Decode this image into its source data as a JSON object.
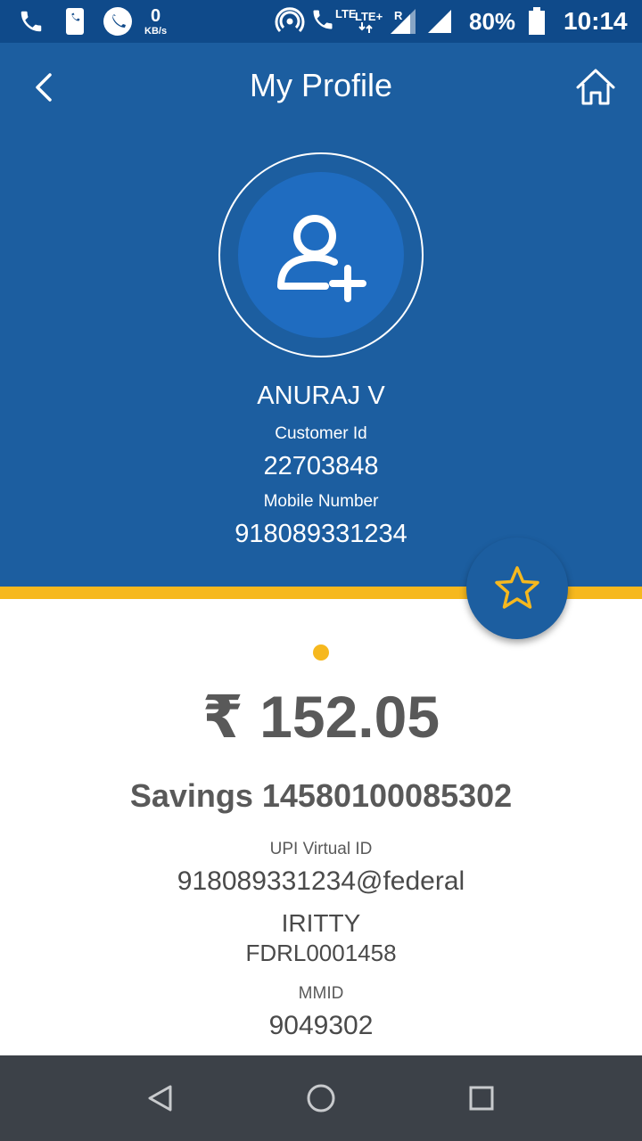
{
  "status_bar": {
    "data_rate_value": "0",
    "data_rate_unit": "KB/s",
    "network_label_1": "LTE",
    "network_label_2": "LTE+",
    "roaming_label": "R",
    "battery_percent": "80%",
    "battery_level": 0.8,
    "time": "10:14",
    "icons": [
      "phone-icon",
      "phone-device-icon",
      "whatsapp-icon",
      "hotspot-icon",
      "volte-call-icon",
      "signal-icon",
      "battery-icon"
    ]
  },
  "header": {
    "title": "My Profile",
    "back_icon": "chevron-left-icon",
    "home_icon": "home-icon"
  },
  "profile": {
    "avatar_icon": "add-user-icon",
    "name": "ANURAJ V",
    "customer_id_label": "Customer Id",
    "customer_id": "22703848",
    "mobile_label": "Mobile Number",
    "mobile": "918089331234",
    "favorite_icon": "star-icon"
  },
  "account": {
    "balance": "₹ 152.05",
    "account_line": "Savings 14580100085302",
    "upi_label": "UPI Virtual ID",
    "upi_id": "918089331234@federal",
    "branch": "IRITTY",
    "ifsc": "FDRL0001458",
    "mmid_label": "MMID",
    "mmid": "9049302"
  },
  "navigation": {
    "icons": [
      "back-triangle-icon",
      "home-circle-icon",
      "recents-square-icon"
    ]
  },
  "colors": {
    "status_bar_bg": "#0f4a8a",
    "header_bg": "#1c5ea0",
    "avatar_bg": "#1f6cc0",
    "accent_yellow": "#f6b81e",
    "text_dark": "#595959",
    "nav_bar_bg": "#3c4148"
  }
}
